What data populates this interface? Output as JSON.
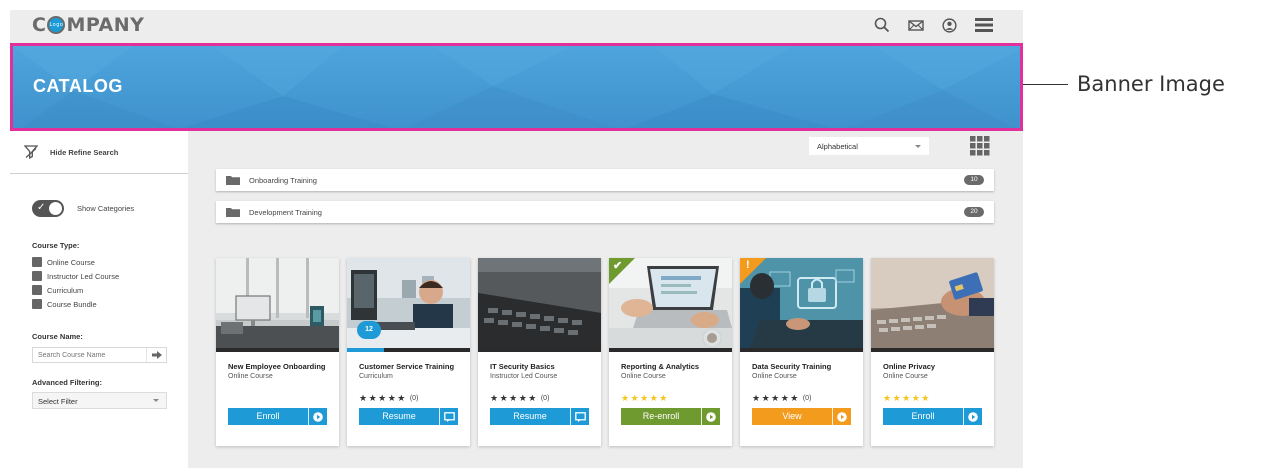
{
  "header": {
    "logo_start": "C",
    "logo_badge": "Logo",
    "logo_end": "MPANY",
    "icons": [
      "search-icon",
      "mail-icon",
      "user-icon",
      "menu-icon"
    ]
  },
  "banner": {
    "title": "CATALOG",
    "callout": "Banner Image"
  },
  "sidebar": {
    "hide_refine": "Hide Refine Search",
    "show_categories": "Show Categories",
    "course_type_label": "Course Type:",
    "course_types": [
      "Online Course",
      "Instructor Led Course",
      "Curriculum",
      "Course Bundle"
    ],
    "course_name_label": "Course Name:",
    "search_placeholder": "Search Course Name",
    "advanced_label": "Advanced Filtering:",
    "filter_value": "Select Filter"
  },
  "toolbar": {
    "sort_value": "Alphabetical"
  },
  "categories": [
    {
      "name": "Onboarding Training",
      "count": "10"
    },
    {
      "name": "Development Training",
      "count": "20"
    }
  ],
  "courses": [
    {
      "title": "New Employee Onboarding",
      "type": "Online Course",
      "button": "Enroll",
      "button_color": "#1e9ad6"
    },
    {
      "title": "Customer Service Training",
      "type": "Curriculum",
      "rating_count": "(0)",
      "button": "Resume",
      "badge": "12",
      "progress": 0.3,
      "button_color": "#1e9ad6"
    },
    {
      "title": "IT Security Basics",
      "type": "Instructor Led Course",
      "rating_count": "(0)",
      "button": "Resume",
      "button_color": "#1e9ad6"
    },
    {
      "title": "Reporting & Analytics",
      "type": "Online Course",
      "button": "Re-enroll",
      "corner": "✔",
      "corner_color": "#6f9a30",
      "button_color": "#6f9a30"
    },
    {
      "title": "Data Security Training",
      "type": "Online Course",
      "rating_count": "(0)",
      "button": "View",
      "corner": "!",
      "corner_color": "#f39b1d",
      "button_color": "#f39b1d"
    },
    {
      "title": "Online Privacy",
      "type": "Online Course",
      "button": "Enroll",
      "button_color": "#1e9ad6"
    }
  ],
  "colors": {
    "accent": "#1e9ad6",
    "banner": "#3f92cd",
    "highlight_border": "#e2309a",
    "complete": "#6f9a30",
    "warning": "#f39b1d",
    "star_gold": "#f4c51d"
  }
}
